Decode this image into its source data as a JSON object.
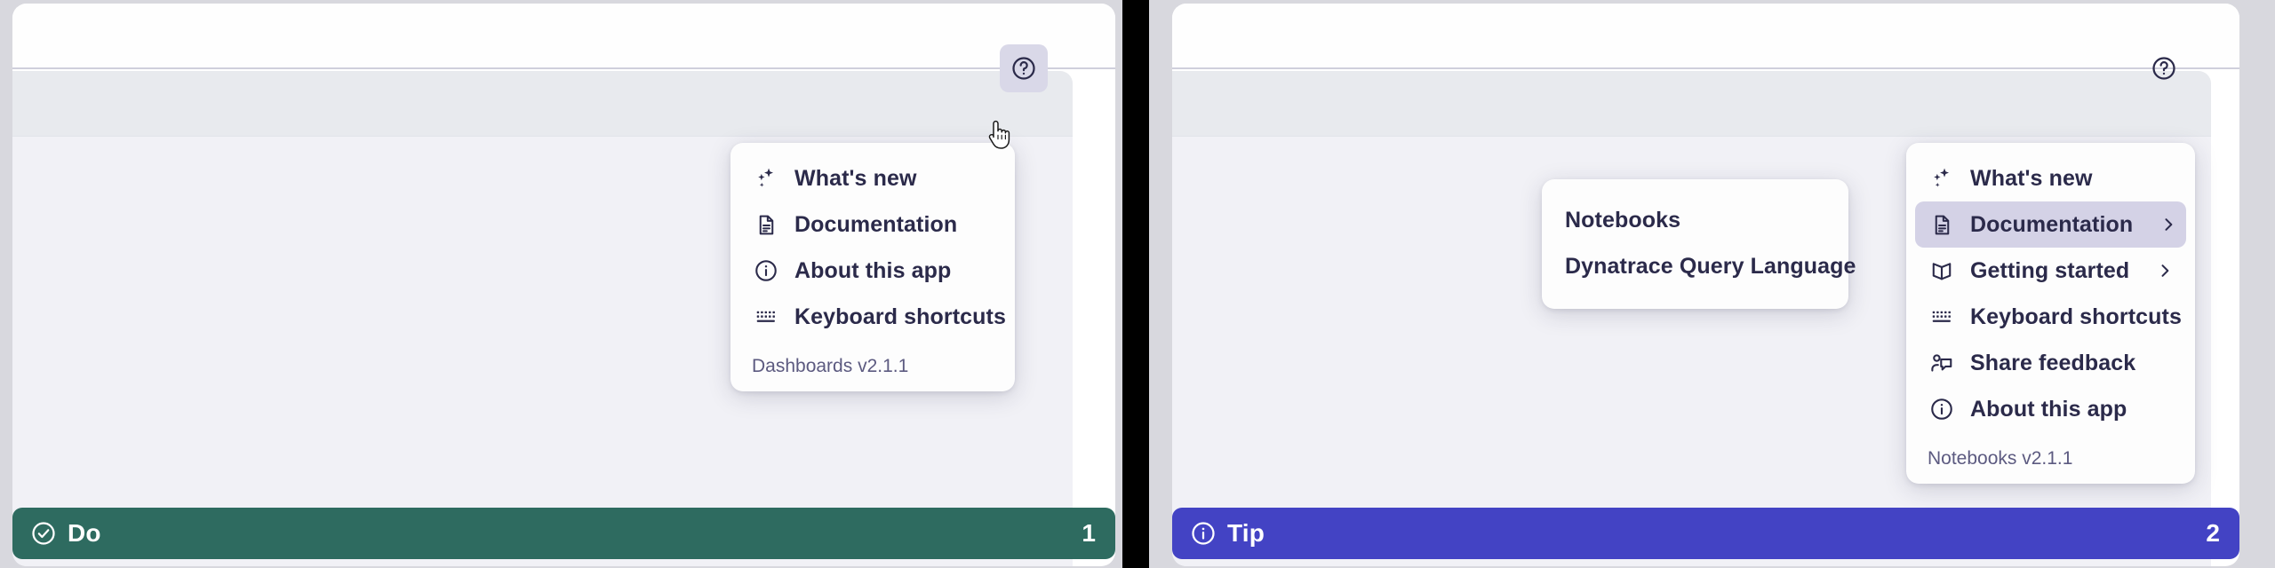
{
  "panels": [
    {
      "id": "left",
      "help_button": {
        "icon": "help-circle-icon",
        "state": "active"
      },
      "menu": {
        "items": [
          {
            "icon": "sparkles-icon",
            "label": "What's new",
            "has_submenu": false,
            "highlighted": false
          },
          {
            "icon": "document-icon",
            "label": "Documentation",
            "has_submenu": false,
            "highlighted": false
          },
          {
            "icon": "info-circle-icon",
            "label": "About this app",
            "has_submenu": false,
            "highlighted": false
          },
          {
            "icon": "keyboard-icon",
            "label": "Keyboard shortcuts",
            "has_submenu": false,
            "highlighted": false
          }
        ],
        "footer": "Dashboards v2.1.1"
      },
      "submenu": null,
      "banner": {
        "icon": "check-circle-icon",
        "label": "Do",
        "number": "1",
        "color": "#2e6b60"
      }
    },
    {
      "id": "right",
      "help_button": {
        "icon": "help-circle-icon",
        "state": "default"
      },
      "menu": {
        "items": [
          {
            "icon": "sparkles-icon",
            "label": "What's new",
            "has_submenu": false,
            "highlighted": false
          },
          {
            "icon": "document-icon",
            "label": "Documentation",
            "has_submenu": true,
            "highlighted": true
          },
          {
            "icon": "book-icon",
            "label": "Getting started",
            "has_submenu": true,
            "highlighted": false
          },
          {
            "icon": "keyboard-icon",
            "label": "Keyboard shortcuts",
            "has_submenu": false,
            "highlighted": false
          },
          {
            "icon": "feedback-icon",
            "label": "Share feedback",
            "has_submenu": false,
            "highlighted": false
          },
          {
            "icon": "info-circle-icon",
            "label": "About this app",
            "has_submenu": false,
            "highlighted": false
          }
        ],
        "footer": "Notebooks v2.1.1"
      },
      "submenu": {
        "items": [
          {
            "label": "Notebooks"
          },
          {
            "label": "Dynatrace Query Language"
          }
        ]
      },
      "banner": {
        "icon": "info-circle-icon",
        "label": "Tip",
        "number": "2",
        "color": "#4343c4"
      }
    }
  ],
  "colors": {
    "menu_text": "#2b2a4a",
    "menu_footer_text": "#5c5a80",
    "highlight_bg": "#d4d2e6",
    "toolbar_bg": "#e8eaee",
    "content_bg": "#f1f1f6",
    "banner_do": "#2e6b60",
    "banner_tip": "#4343c4",
    "panel_gap": "#000000"
  }
}
